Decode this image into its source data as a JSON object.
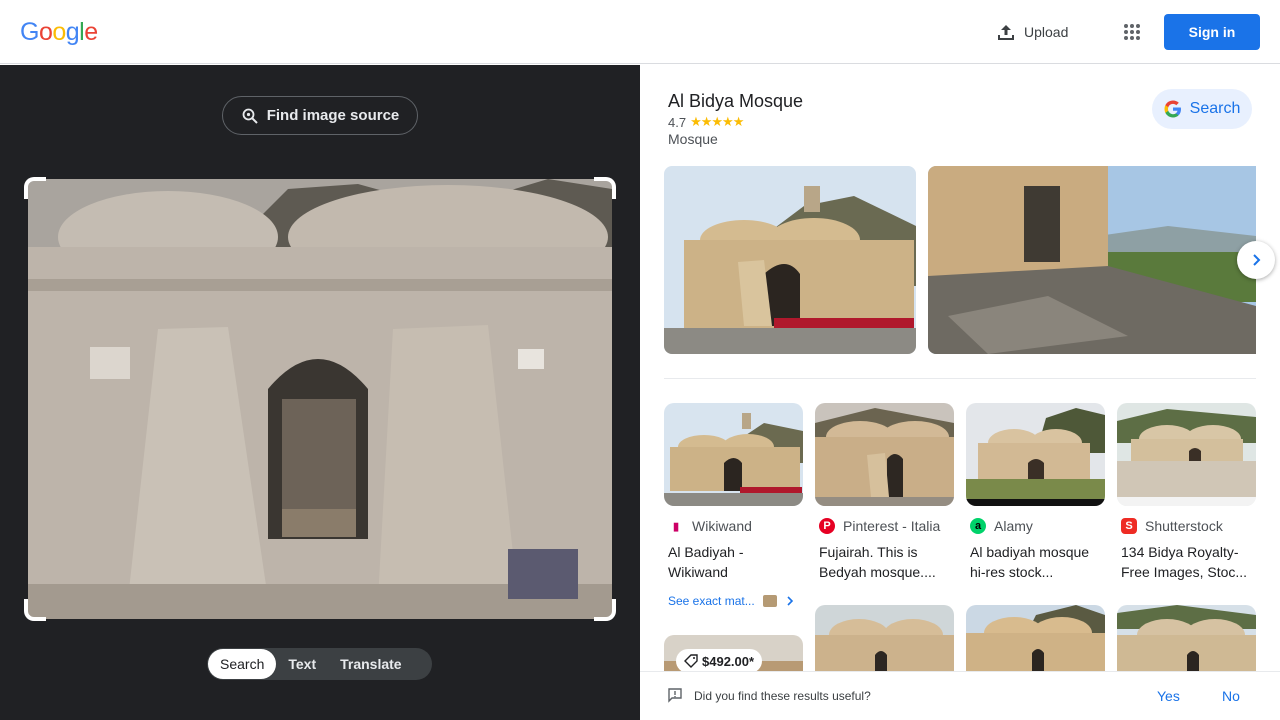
{
  "header": {
    "logo": [
      "G",
      "o",
      "o",
      "g",
      "l",
      "e"
    ],
    "logo_colors": [
      "#4285f4",
      "#ea4335",
      "#fbbc05",
      "#4285f4",
      "#34a853",
      "#ea4335"
    ],
    "upload_label": "Upload",
    "signin_label": "Sign in"
  },
  "left": {
    "find_source_label": "Find image source",
    "tabs": [
      "Search",
      "Text",
      "Translate"
    ],
    "active_tab": "Search"
  },
  "entity": {
    "title": "Al Bidya Mosque",
    "rating": "4.7",
    "stars": "★★★★★",
    "type": "Mosque",
    "search_label": "Search"
  },
  "results": [
    {
      "source": "Wikiwand",
      "title": "Al Badiyah - Wikiwand",
      "icon": "wikiwand-icon",
      "color": "#ffffff"
    },
    {
      "source": "Pinterest - Italia",
      "title": "Fujairah. This is Bedyah mosque....",
      "icon": "pinterest-icon",
      "color": "#e60023"
    },
    {
      "source": "Alamy",
      "title": "Al badiyah mosque hi-res stock...",
      "icon": "alamy-icon",
      "color": "#00d26a"
    },
    {
      "source": "Shutterstock",
      "title": "134 Bidya Royalty-Free Images, Stoc...",
      "icon": "shutterstock-icon",
      "color": "#ee2b24"
    }
  ],
  "exact_matches_label": "See exact mat...",
  "price_tag": "$492.00*",
  "feedback": {
    "question": "Did you find these results useful?",
    "yes": "Yes",
    "no": "No"
  }
}
